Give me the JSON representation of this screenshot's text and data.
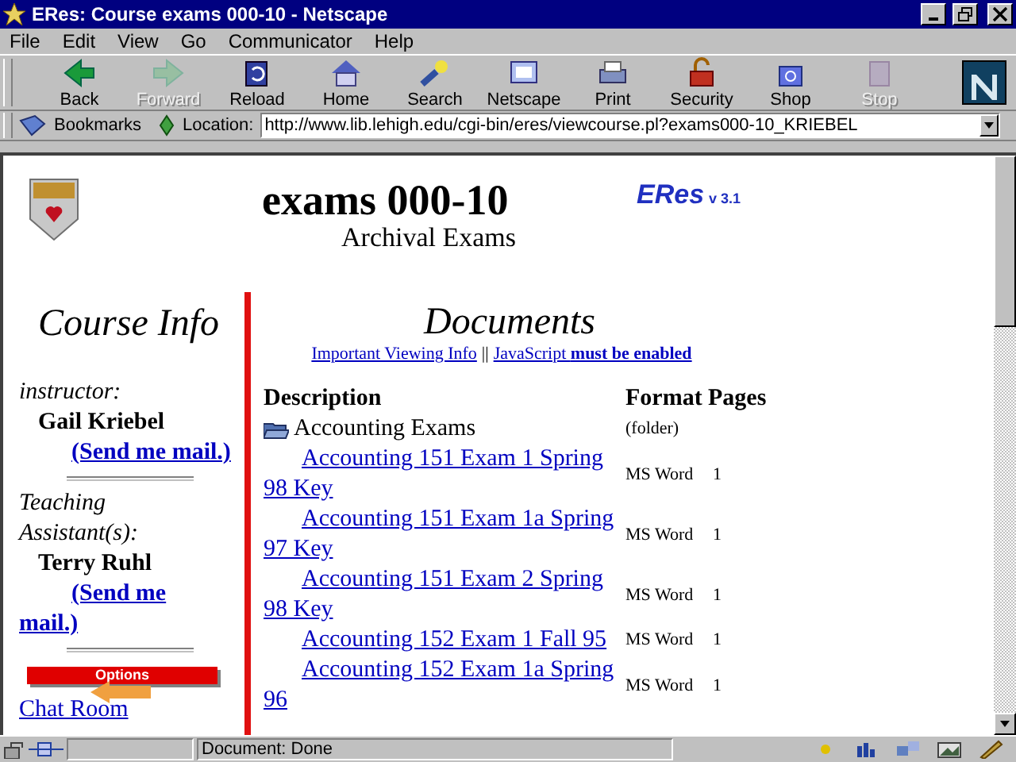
{
  "window": {
    "title": "ERes: Course exams 000-10 - Netscape"
  },
  "menu": [
    "File",
    "Edit",
    "View",
    "Go",
    "Communicator",
    "Help"
  ],
  "toolbar": [
    {
      "label": "Back",
      "disabled": false
    },
    {
      "label": "Forward",
      "disabled": true
    },
    {
      "label": "Reload",
      "disabled": false
    },
    {
      "label": "Home",
      "disabled": false
    },
    {
      "label": "Search",
      "disabled": false
    },
    {
      "label": "Netscape",
      "disabled": false
    },
    {
      "label": "Print",
      "disabled": false
    },
    {
      "label": "Security",
      "disabled": false
    },
    {
      "label": "Shop",
      "disabled": false
    },
    {
      "label": "Stop",
      "disabled": true
    }
  ],
  "location_bar": {
    "bookmarks": "Bookmarks",
    "label": "Location:",
    "url": "http://www.lib.lehigh.edu/cgi-bin/eres/viewcourse.pl?exams000-10_KRIEBEL"
  },
  "page": {
    "title": "exams 000-10",
    "subtitle": "Archival Exams",
    "logo_text": "ERes",
    "version": "v 3.1",
    "sidebar": {
      "heading": "Course Info",
      "instructor_label": "instructor:",
      "instructor": "Gail Kriebel",
      "instructor_mail": "(Send me mail.)",
      "ta_label": "Teaching Assistant(s):",
      "ta": "Terry Ruhl",
      "ta_mail": "(Send me mail.)",
      "options": "Options",
      "links": [
        "Chat Room"
      ]
    },
    "documents": {
      "heading": "Documents",
      "info_link": "Important Viewing Info",
      "separator": "||",
      "js_link": "JavaScript **must be enabled**",
      "columns": [
        "Description",
        "Format",
        "Pages"
      ],
      "rows": [
        {
          "kind": "folder",
          "description": "Accounting Exams",
          "format": "(folder)"
        },
        {
          "kind": "document",
          "description": "Accounting 151 Exam 1 Spring 98 Key",
          "format": "MS Word",
          "pages": "1"
        },
        {
          "kind": "document",
          "description": "Accounting 151 Exam 1a Spring 97 Key",
          "format": "MS Word",
          "pages": "1"
        },
        {
          "kind": "document",
          "description": "Accounting 151 Exam 2 Spring 98 Key",
          "format": "MS Word",
          "pages": "1"
        },
        {
          "kind": "document",
          "description": "Accounting 152 Exam 1 Fall 95",
          "format": "MS Word",
          "pages": "1"
        },
        {
          "kind": "document",
          "description": "Accounting 152 Exam 1a Spring 96",
          "format": "MS Word",
          "pages": "1"
        }
      ]
    }
  },
  "status_bar": {
    "text": "Document: Done"
  }
}
